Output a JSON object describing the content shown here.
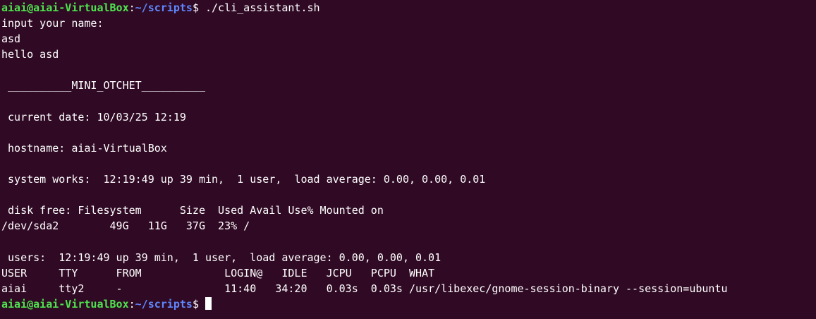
{
  "prompt": {
    "user_host": "aiai@aiai-VirtualBox",
    "colon": ":",
    "path": "~/scripts",
    "dollar": "$ "
  },
  "lines": [
    "./cli_assistant.sh",
    "input your name:",
    "asd",
    "hello asd",
    "",
    " __________MINI_OTCHET__________",
    "",
    " current date: 10/03/25 12:19",
    "",
    " hostname: aiai-VirtualBox",
    "",
    " system works:  12:19:49 up 39 min,  1 user,  load average: 0.00, 0.00, 0.01",
    "",
    " disk free: Filesystem      Size  Used Avail Use% Mounted on",
    "/dev/sda2        49G   11G   37G  23% /",
    "",
    " users:  12:19:49 up 39 min,  1 user,  load average: 0.00, 0.00, 0.01",
    "USER     TTY      FROM             LOGIN@   IDLE   JCPU   PCPU  WHAT",
    "aiai     tty2     -                11:40   34:20   0.03s  0.03s /usr/libexec/gnome-session-binary --session=ubuntu"
  ],
  "colors": {
    "background": "#300a24",
    "prompt_user": "#4ee34e",
    "prompt_path": "#5f87ff",
    "text": "#ffffff"
  }
}
